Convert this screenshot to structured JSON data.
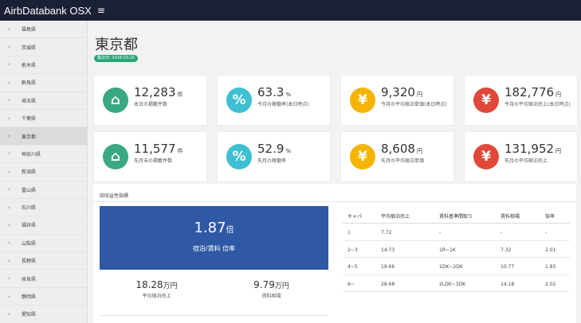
{
  "app": {
    "title": "AirbDatabank OSX",
    "menu_glyph": "≡"
  },
  "sidebar": {
    "items": [
      {
        "label": "福島県",
        "active": false
      },
      {
        "label": "茨城県",
        "active": false
      },
      {
        "label": "栃木県",
        "active": false
      },
      {
        "label": "群馬県",
        "active": false
      },
      {
        "label": "埼玉県",
        "active": false
      },
      {
        "label": "千葉県",
        "active": false
      },
      {
        "label": "東京都",
        "active": true
      },
      {
        "label": "神奈川県",
        "active": false
      },
      {
        "label": "新潟県",
        "active": false
      },
      {
        "label": "富山県",
        "active": false
      },
      {
        "label": "石川県",
        "active": false
      },
      {
        "label": "福井県",
        "active": false
      },
      {
        "label": "山梨県",
        "active": false
      },
      {
        "label": "長野県",
        "active": false
      },
      {
        "label": "岐阜県",
        "active": false
      },
      {
        "label": "静岡県",
        "active": false
      },
      {
        "label": "愛知県",
        "active": false
      }
    ]
  },
  "page": {
    "title": "東京都",
    "date_badge": "集計日: 2016-03-21"
  },
  "colors": {
    "green": "#3aa880",
    "teal": "#3ebfd2",
    "yellow": "#f4b400",
    "red": "#e0483a",
    "blue": "#2f58a5"
  },
  "cards": [
    {
      "icon": "home-icon",
      "glyph": "⌂",
      "color": "#3aa880",
      "value": "12,283",
      "unit": "件",
      "label": "本日の掲載件数"
    },
    {
      "icon": "percent-icon",
      "glyph": "%",
      "color": "#3ebfd2",
      "value": "63.3",
      "unit": "%",
      "label": "今月の稼働率(本日時点)"
    },
    {
      "icon": "yen-icon",
      "glyph": "¥",
      "color": "#f4b400",
      "value": "9,320",
      "unit": "円",
      "label": "今月の平均宿泊単価(本日時点)"
    },
    {
      "icon": "yen-icon",
      "glyph": "¥",
      "color": "#e0483a",
      "value": "182,776",
      "unit": "円",
      "label": "今月の平均宿泊売上(本日時点)"
    },
    {
      "icon": "home-icon",
      "glyph": "⌂",
      "color": "#3aa880",
      "value": "11,577",
      "unit": "件",
      "label": "先月末の掲載件数"
    },
    {
      "icon": "percent-icon",
      "glyph": "%",
      "color": "#3ebfd2",
      "value": "52.9",
      "unit": "%",
      "label": "先月の稼働率"
    },
    {
      "icon": "yen-icon",
      "glyph": "¥",
      "color": "#f4b400",
      "value": "8,608",
      "unit": "円",
      "label": "先月の平均宿泊単価"
    },
    {
      "icon": "yen-icon",
      "glyph": "¥",
      "color": "#e0483a",
      "value": "131,952",
      "unit": "円",
      "label": "先月の平均宿泊売上"
    }
  ],
  "panel": {
    "title": "田収益性指標",
    "ratio": {
      "value": "1.87",
      "unit": "倍",
      "label": "宿泊/賃料 倍率"
    },
    "stats": [
      {
        "value": "18.28",
        "unit": "万円",
        "label": "平均宿泊売上"
      },
      {
        "value": "9.79",
        "unit": "万円",
        "label": "賃料相場"
      }
    ],
    "table": {
      "headers": [
        "キャパ",
        "平均宿泊売上",
        "賃料基準間取り",
        "賃料相場",
        "倍率"
      ],
      "rows": [
        [
          "1",
          "7.72",
          "-",
          "-",
          "-"
        ],
        [
          "2~3",
          "14.73",
          "1R~1K",
          "7.32",
          "2.01"
        ],
        [
          "4~5",
          "19.66",
          "1DK~2DK",
          "10.77",
          "1.83"
        ],
        [
          "6~",
          "28.68",
          "2LDK~3DK",
          "14.18",
          "2.02"
        ]
      ]
    }
  }
}
